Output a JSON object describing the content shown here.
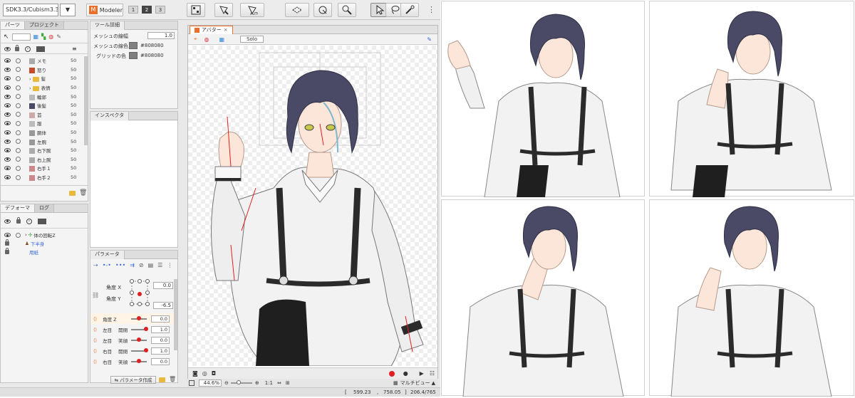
{
  "toolbar": {
    "model_path": "SDK3.3/Cubism3.3",
    "mode_letter": "M",
    "mode_label": "Modeler",
    "layout_buttons": [
      "1",
      "2",
      "3"
    ]
  },
  "parts_panel": {
    "tabs": [
      "パーツ",
      "プロジェクト"
    ],
    "items": [
      {
        "name": "メモ",
        "value": "50"
      },
      {
        "name": "怒り",
        "value": "50"
      },
      {
        "name": "髪",
        "value": "50"
      },
      {
        "name": "表情",
        "value": "50"
      },
      {
        "name": "輪郭",
        "value": "50"
      },
      {
        "name": "後髪",
        "value": "50"
      },
      {
        "name": "首",
        "value": "50"
      },
      {
        "name": "服",
        "value": "50"
      },
      {
        "name": "胴体",
        "value": "50"
      },
      {
        "name": "左腕",
        "value": "50"
      },
      {
        "name": "右下腕",
        "value": "50"
      },
      {
        "name": "右上腕",
        "value": "50"
      },
      {
        "name": "右手１",
        "value": "50"
      },
      {
        "name": "右手２",
        "value": "50"
      }
    ]
  },
  "deformer_panel": {
    "tabs": [
      "デフォーマ",
      "ログ"
    ],
    "items": [
      "体の回転Z",
      "下半身",
      "用紙"
    ]
  },
  "tool_details": {
    "title": "ツール詳細",
    "mesh_line_width_label": "メッシュの線幅",
    "mesh_line_width_value": "1.0",
    "mesh_line_color_label": "メッシュの線色",
    "mesh_line_color_value": "#808080",
    "grid_color_label": "グリッドの色",
    "grid_color_value": "#808080"
  },
  "inspector": {
    "title": "インスペクタ"
  },
  "parameters": {
    "title": "パラメータ",
    "angle_x_label": "角度 X",
    "angle_x_value": "0.0",
    "angle_y_label": "角度 Y",
    "angle_y_value": "-6.5",
    "rows": [
      {
        "name": "角度 Z",
        "sub": "",
        "value": "0.0"
      },
      {
        "name": "左目",
        "sub": "開閉",
        "value": "1.0"
      },
      {
        "name": "左目",
        "sub": "笑顔",
        "value": "0.0"
      },
      {
        "name": "右目",
        "sub": "開閉",
        "value": "1.0"
      },
      {
        "name": "右目",
        "sub": "笑顔",
        "value": "0.0"
      }
    ],
    "create_button": "パラメータ作成"
  },
  "canvas": {
    "tab_label": "アバター",
    "solo_label": "Solo",
    "zoom": "44.6",
    "zoom_unit": "%",
    "ratio_label": "1:1",
    "multiview_label": "マルチビュー"
  },
  "status_bar": {
    "coord_x": "599.23",
    "coord_y": "758.05",
    "info": "206.4/765"
  },
  "colors": {
    "accent_orange": "#e8702a",
    "record_red": "#e02020",
    "suspender": "#2b2b2b",
    "hair": "#4a4a66"
  }
}
